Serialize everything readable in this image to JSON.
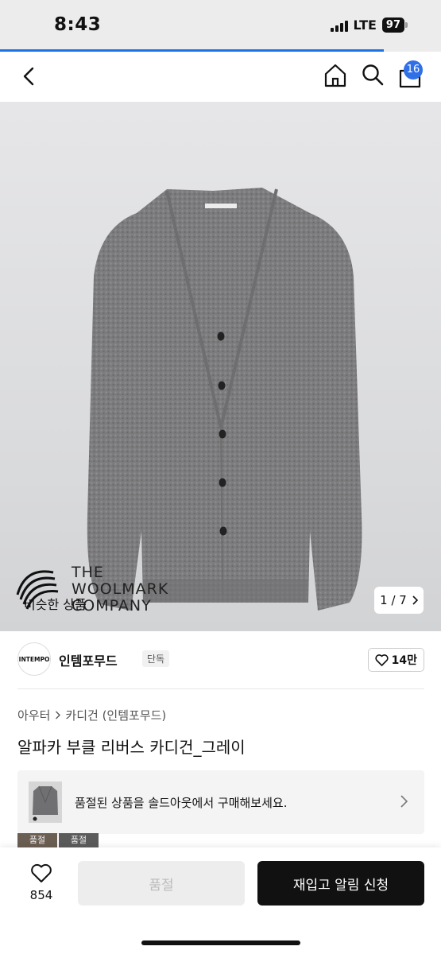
{
  "status_bar": {
    "time": "8:43",
    "network": "LTE",
    "battery": "97"
  },
  "page_load_progress": 0.87,
  "nav": {
    "cart_count": "16"
  },
  "hero": {
    "woolmark_lines": [
      "THE",
      "WOOLMARK",
      "COMPANY"
    ],
    "similar_label": "비슷한 상품",
    "page_indicator": "1 / 7"
  },
  "brand": {
    "logo_text": "INTEMPO",
    "name": "인템포무드",
    "tag": "단독",
    "likes": "14만"
  },
  "breadcrumb": {
    "category": "아우터",
    "subcategory": "카디건 (인템포무드)"
  },
  "product": {
    "title": "알파카 부클 리버스 카디건_그레이"
  },
  "soldout_banner": {
    "text": "품절된 상품을 솔드아웃에서 구매해보세요."
  },
  "thumb_strip": [
    "품절",
    "품절"
  ],
  "bottom_bar": {
    "wish_count": "854",
    "soldout_label": "품절",
    "restock_label": "재입고 알림 신청"
  },
  "colors": {
    "accent": "#2f6fe8",
    "primary_button": "#111111",
    "disabled_button": "#ededed"
  }
}
